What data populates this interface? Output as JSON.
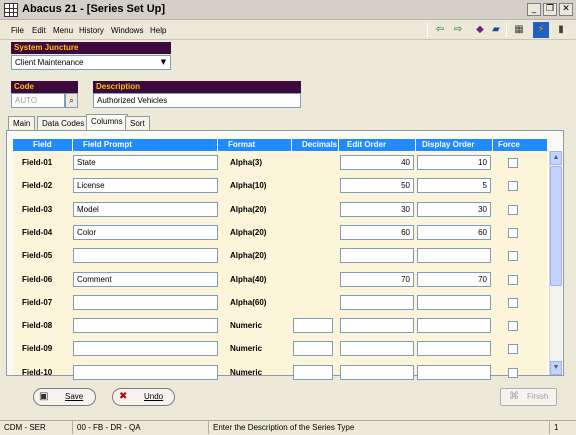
{
  "window": {
    "title": "Abacus 21 - [Series Set Up]"
  },
  "menu": [
    "File",
    "Edit",
    "Menu",
    "History",
    "Windows",
    "Help"
  ],
  "system_juncture": {
    "label": "System Juncture",
    "value": "Client Maintenance"
  },
  "code": {
    "label": "Code",
    "value": "AUTO"
  },
  "description": {
    "label": "Description",
    "value": "Authorized Vehicles"
  },
  "tabs": [
    "Main",
    "Data Codes",
    "Columns",
    "Sort"
  ],
  "active_tab": "Columns",
  "grid": {
    "headers": [
      "Field",
      "Field Prompt",
      "Format",
      "Decimals",
      "Edit Order",
      "Display Order",
      "Force"
    ],
    "rows": [
      {
        "field": "Field-01",
        "prompt": "State",
        "format": "Alpha(3)",
        "decimals": "",
        "edit": "40",
        "display": "10"
      },
      {
        "field": "Field-02",
        "prompt": "License",
        "format": "Alpha(10)",
        "decimals": "",
        "edit": "50",
        "display": "5"
      },
      {
        "field": "Field-03",
        "prompt": "Model",
        "format": "Alpha(20)",
        "decimals": "",
        "edit": "30",
        "display": "30"
      },
      {
        "field": "Field-04",
        "prompt": "Color",
        "format": "Alpha(20)",
        "decimals": "",
        "edit": "60",
        "display": "60"
      },
      {
        "field": "Field-05",
        "prompt": "",
        "format": "Alpha(20)",
        "decimals": "",
        "edit": "",
        "display": ""
      },
      {
        "field": "Field-06",
        "prompt": "Comment",
        "format": "Alpha(40)",
        "decimals": "",
        "edit": "70",
        "display": "70"
      },
      {
        "field": "Field-07",
        "prompt": "",
        "format": "Alpha(60)",
        "decimals": "",
        "edit": "",
        "display": ""
      },
      {
        "field": "Field-08",
        "prompt": "",
        "format": "Numeric",
        "decimals": "",
        "edit": "",
        "display": ""
      },
      {
        "field": "Field-09",
        "prompt": "",
        "format": "Numeric",
        "decimals": "",
        "edit": "",
        "display": ""
      },
      {
        "field": "Field-10",
        "prompt": "",
        "format": "Numeric",
        "decimals": "",
        "edit": "",
        "display": ""
      }
    ]
  },
  "buttons": {
    "save": "Save",
    "undo": "Undo",
    "finish": "Finish"
  },
  "status": [
    "CDM - SER",
    "00 - FB - DR - QA",
    "Enter the Description of the Series Type",
    "1"
  ],
  "colors": {
    "grid_header": "#1f8bff",
    "label_bg": "#3c0a3c",
    "label_fg": "#ffc000",
    "grid_body": "#fdf5da"
  }
}
